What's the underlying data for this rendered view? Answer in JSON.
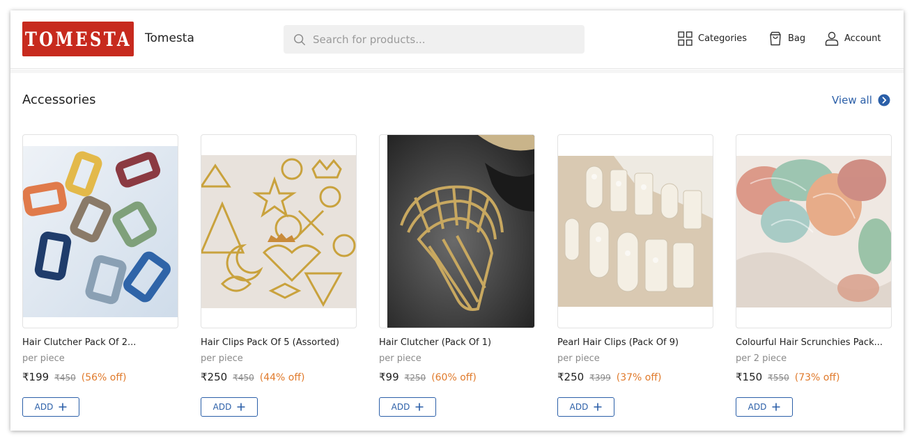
{
  "header": {
    "logo_text": "TOMESTA",
    "brand_name": "Tomesta",
    "search_placeholder": "Search for products...",
    "nav": {
      "categories": "Categories",
      "bag": "Bag",
      "account": "Account"
    }
  },
  "section": {
    "title": "Accessories",
    "view_all": "View all"
  },
  "products": [
    {
      "name": "Hair Clutcher Pack Of 2...",
      "unit": "per piece",
      "price": "₹199",
      "mrp": "₹450",
      "discount": "(56% off)",
      "add_label": "ADD"
    },
    {
      "name": "Hair Clips Pack Of 5 (Assorted)",
      "unit": "per piece",
      "price": "₹250",
      "mrp": "₹450",
      "discount": "(44% off)",
      "add_label": "ADD"
    },
    {
      "name": "Hair Clutcher (Pack Of 1)",
      "unit": "per piece",
      "price": "₹99",
      "mrp": "₹250",
      "discount": "(60% off)",
      "add_label": "ADD"
    },
    {
      "name": "Pearl Hair Clips (Pack Of 9)",
      "unit": "per piece",
      "price": "₹250",
      "mrp": "₹399",
      "discount": "(37% off)",
      "add_label": "ADD"
    },
    {
      "name": "Colourful Hair Scrunchies Pack...",
      "unit": "per 2 piece",
      "price": "₹150",
      "mrp": "₹550",
      "discount": "(73% off)",
      "add_label": "ADD"
    }
  ],
  "colors": {
    "brand_red": "#c72a1e",
    "link_blue": "#2b5fa8",
    "discount_orange": "#e07a2b"
  }
}
